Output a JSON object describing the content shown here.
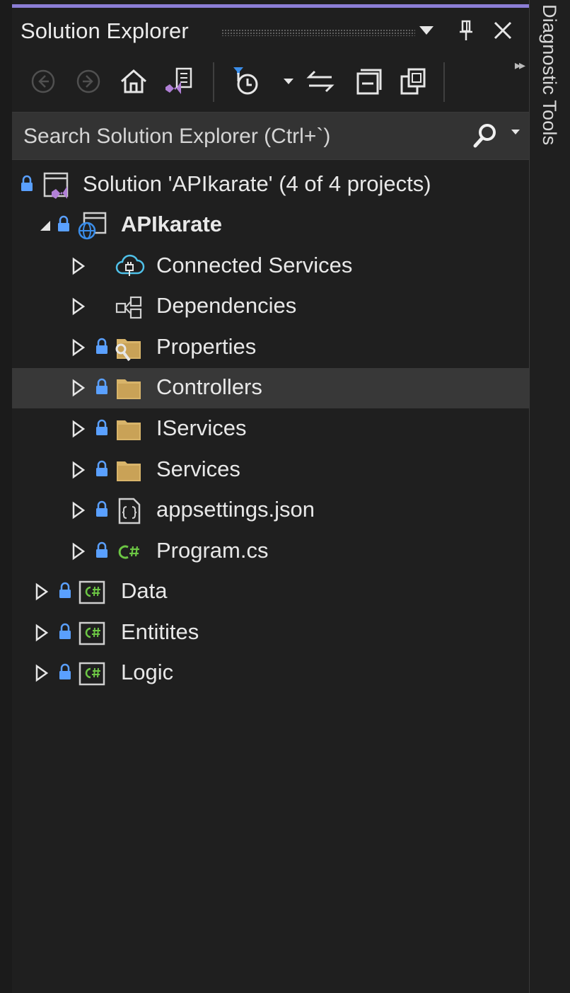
{
  "panel": {
    "title": "Solution Explorer"
  },
  "search": {
    "placeholder": "Search Solution Explorer (Ctrl+`)"
  },
  "side_tab": {
    "label": "Diagnostic Tools"
  },
  "toolbar": {
    "icons": [
      "back-icon",
      "forward-icon",
      "home-icon",
      "switch-views-icon",
      "pending-changes-filter-icon",
      "dropdown-icon",
      "sync-with-active-document-icon",
      "collapse-all-icon",
      "show-all-files-icon"
    ]
  },
  "tree": {
    "solution": "Solution 'APIkarate' (4 of 4 projects)",
    "project": "APIkarate",
    "children": [
      {
        "label": "Connected Services"
      },
      {
        "label": "Dependencies"
      },
      {
        "label": "Properties"
      },
      {
        "label": "Controllers"
      },
      {
        "label": "IServices"
      },
      {
        "label": "Services"
      },
      {
        "label": "appsettings.json"
      },
      {
        "label": "Program.cs"
      }
    ],
    "projects": [
      {
        "label": "Data"
      },
      {
        "label": "Entitites"
      },
      {
        "label": "Logic"
      }
    ]
  },
  "colors": {
    "accent": "#8c7ed6",
    "lock": "#5aa0ff",
    "folder": "#d8b46a",
    "csharp": "#6cc644",
    "selected_row": "#383838",
    "background": "#1f1f1f"
  }
}
